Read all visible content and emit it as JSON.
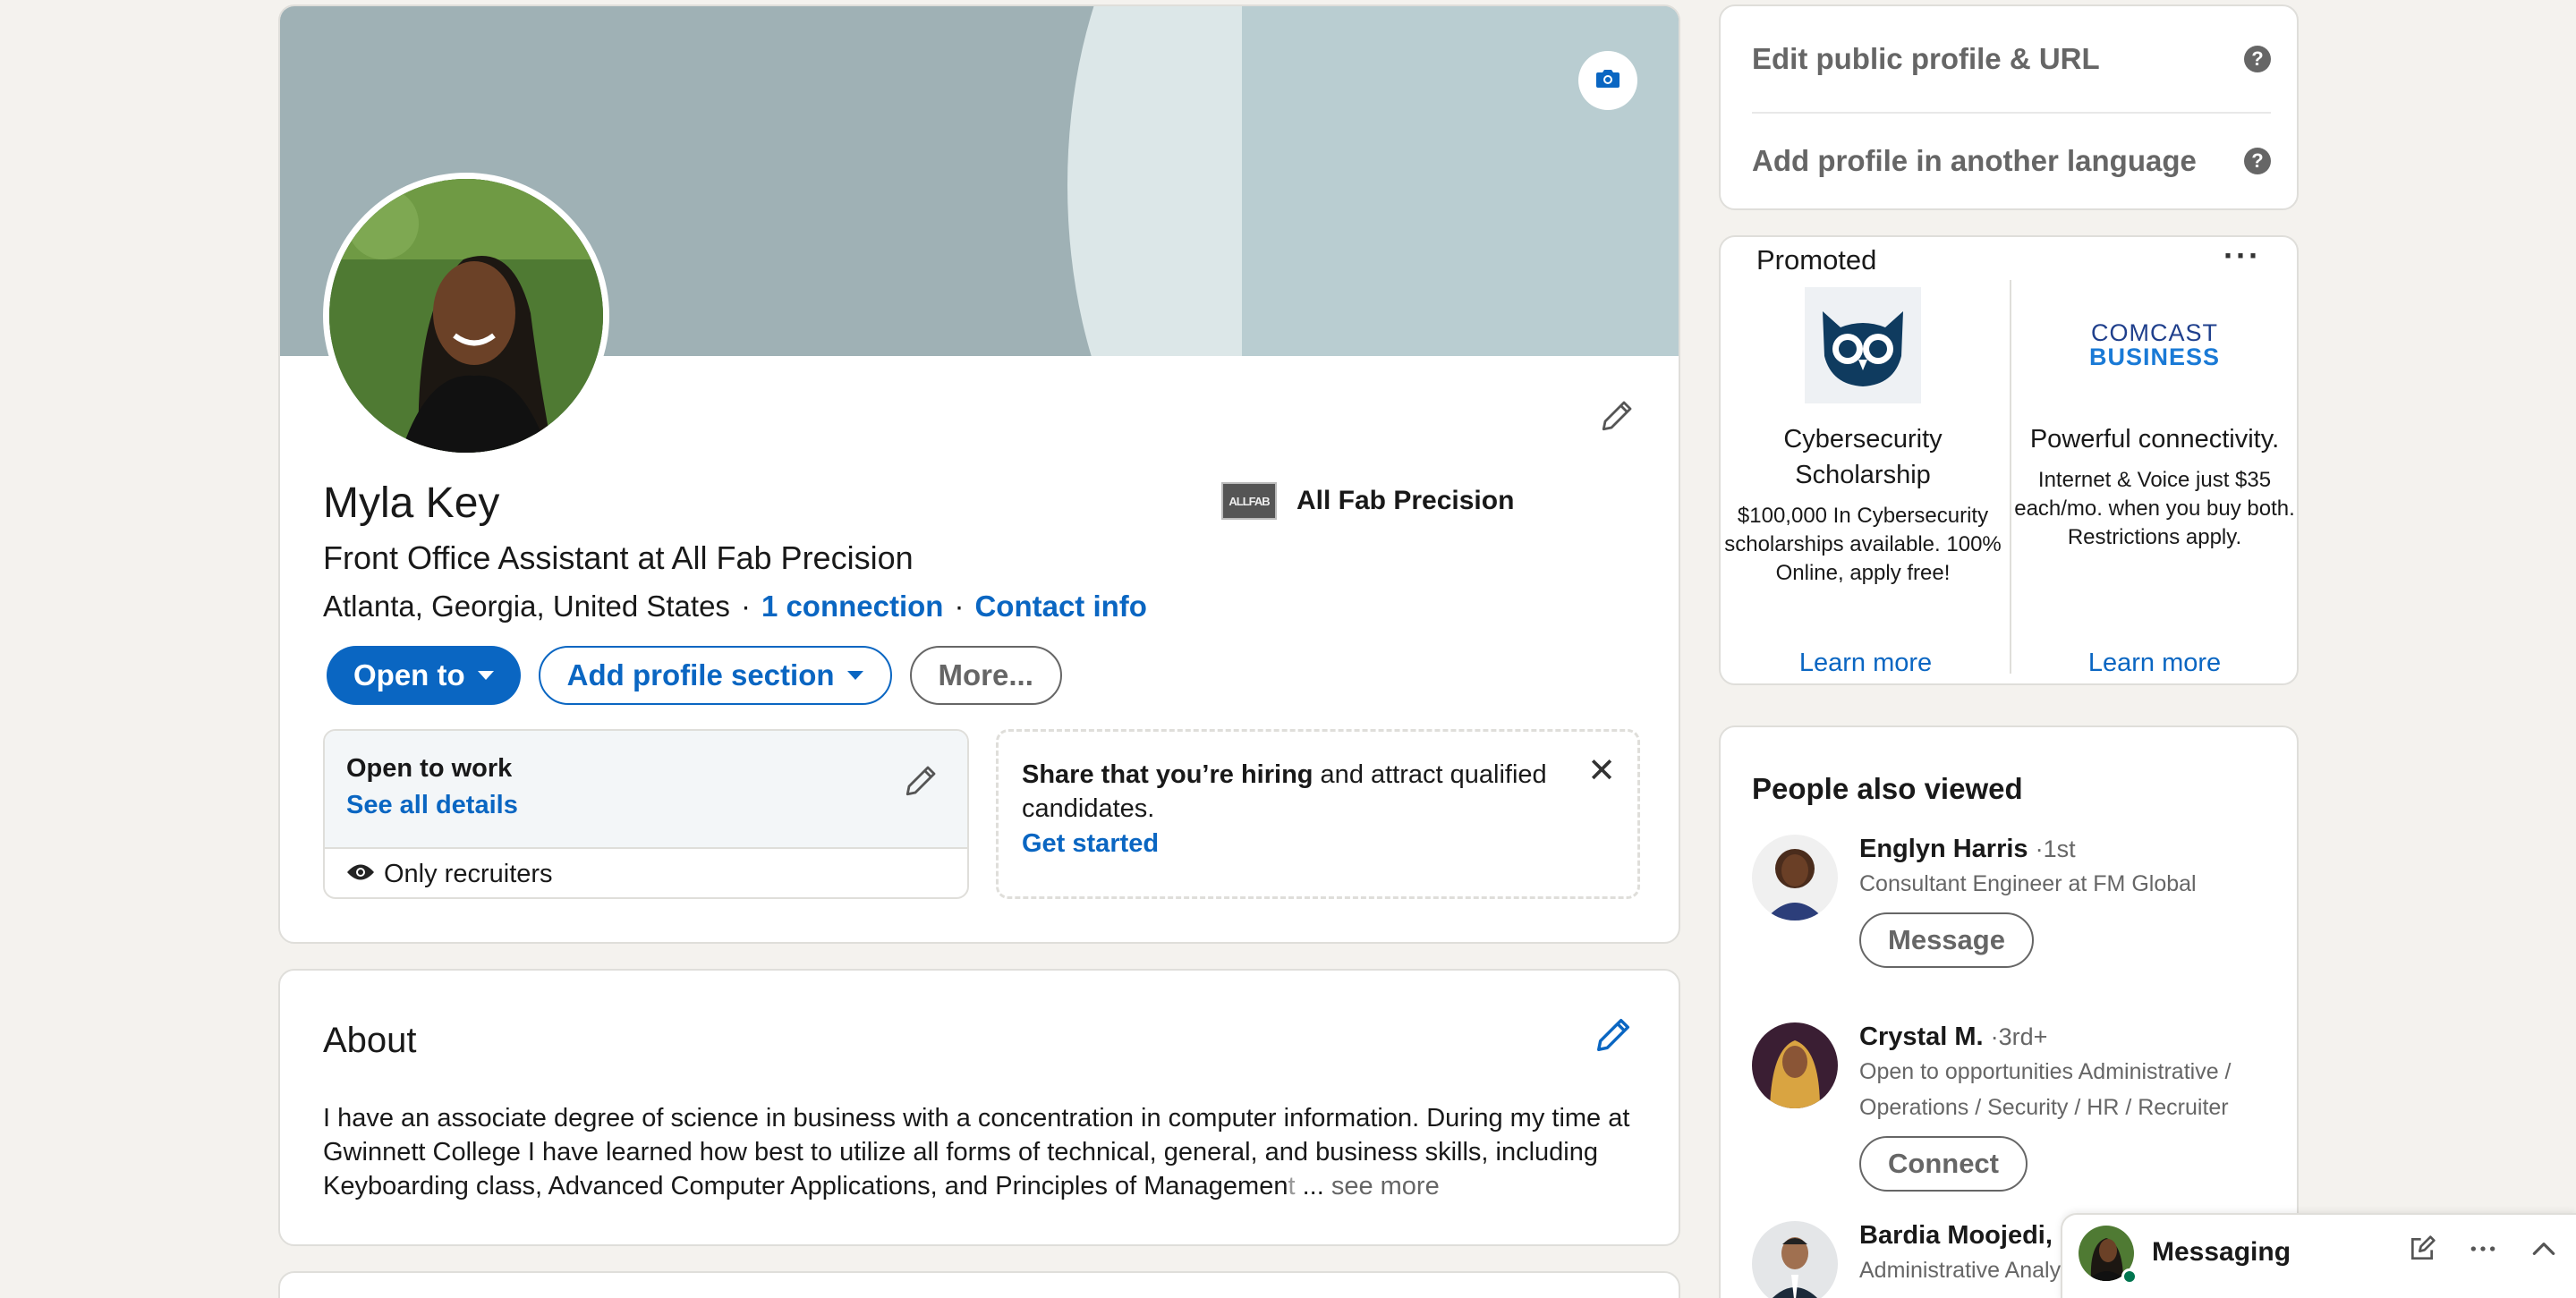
{
  "profile": {
    "name": "Myla Key",
    "headline": "Front Office Assistant at All Fab Precision",
    "location": "Atlanta, Georgia, United States",
    "separator": "·",
    "connections": "1 connection",
    "contact_info": "Contact info",
    "company": {
      "logo_text": "ALLFAB",
      "name": "All Fab Precision"
    },
    "buttons": {
      "open_to": "Open to",
      "add_section": "Add profile section",
      "more": "More..."
    },
    "open_to_work": {
      "title": "Open to work",
      "link": "See all details",
      "visibility": "Only recruiters"
    },
    "hiring": {
      "bold": "Share that you’re hiring",
      "rest": " and attract qualified candidates.",
      "link": "Get started"
    }
  },
  "about": {
    "title": "About",
    "text": "I have an associate degree of science in business with a concentration in computer information. During my time at Gwinnett College I have learned how best to utilize all forms of technical, general, and business skills, including Keyboarding class, Advanced Computer Applications, and Principles of Managemen",
    "faded": "t",
    "ellipsis": " ... ",
    "see_more": "see more"
  },
  "sidebar": {
    "edit_public_profile": "Edit public profile & URL",
    "add_language": "Add profile in another language",
    "help_glyph": "?",
    "promoted": {
      "label": "Promoted",
      "menu_glyph": "···",
      "ads": [
        {
          "headline": "Cybersecurity Scholarship",
          "body": "$100,000 In Cybersecurity scholarships available. 100% Online, apply free!",
          "cta": "Learn more"
        },
        {
          "logo_line1": "COMCAST",
          "logo_line2": "BUSINESS",
          "headline": "Powerful connectivity.",
          "body": "Internet & Voice just $35 each/mo. when you buy both. Restrictions apply.",
          "cta": "Learn more"
        }
      ]
    },
    "people_also_viewed": {
      "title": "People also viewed",
      "people": [
        {
          "name": "Englyn Harris",
          "degree": "·1st",
          "subtitle": "Consultant Engineer at FM Global",
          "action": "Message"
        },
        {
          "name": "Crystal M.",
          "degree": "·3rd+",
          "subtitle": "Open to opportunities Administrative / Operations / Security / HR / Recruiter",
          "action": "Connect"
        },
        {
          "name": "Bardia Moojedi, M",
          "degree": "",
          "subtitle": "Administrative Analy",
          "action": ""
        }
      ]
    }
  },
  "messaging": {
    "title": "Messaging"
  },
  "colors": {
    "linkedin_blue": "#0a66c2",
    "background": "#f4f2ee",
    "online_green": "#01754f"
  }
}
